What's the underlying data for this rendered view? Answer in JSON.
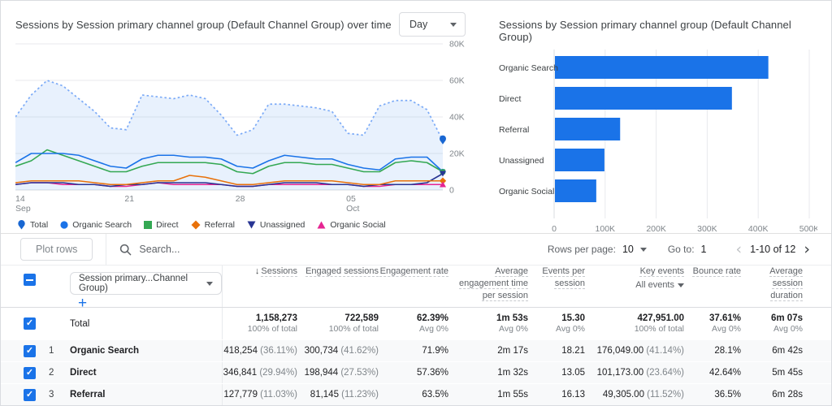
{
  "accent_color": "#1a73e8",
  "line_chart_card": {
    "title": "Sessions by Session primary channel group (Default Channel Group) over time",
    "granularity_value": "Day",
    "legend": [
      {
        "label": "Total",
        "shape": "pin",
        "color": "#1967d2"
      },
      {
        "label": "Organic Search",
        "shape": "circle",
        "color": "#1a73e8"
      },
      {
        "label": "Direct",
        "shape": "square",
        "color": "#34a853"
      },
      {
        "label": "Referral",
        "shape": "diamond",
        "color": "#e8710a"
      },
      {
        "label": "Unassigned",
        "shape": "triangle-down",
        "color": "#283593"
      },
      {
        "label": "Organic Social",
        "shape": "triangle-up",
        "color": "#e52592"
      }
    ]
  },
  "bar_chart_card": {
    "title": "Sessions by Session primary channel group (Default Channel Group)"
  },
  "chart_data": [
    {
      "type": "line",
      "title": "Sessions by Session primary channel group (Default Channel Group) over time",
      "unit": "sessions (thousands)",
      "y_axis": {
        "ticks": [
          "0",
          "20K",
          "40K",
          "60K",
          "80K"
        ],
        "max_k": 80,
        "position": "right"
      },
      "x_axis": {
        "points": 28,
        "tick_labels": [
          {
            "pos": 0,
            "line1": "14",
            "line2": "Sep"
          },
          {
            "pos": 7,
            "line1": "21",
            "line2": ""
          },
          {
            "pos": 14,
            "line1": "28",
            "line2": ""
          },
          {
            "pos": 21,
            "line1": "05",
            "line2": "Oct"
          }
        ]
      },
      "series": [
        {
          "name": "Total",
          "style": "dotted-area",
          "color": "#7baaf7",
          "fill": "rgba(26,115,232,0.10)",
          "marker": "pin",
          "marker_color": "#1967d2",
          "values_k": [
            40,
            52,
            60,
            57,
            50,
            43,
            34,
            33,
            52,
            51,
            50,
            52,
            50,
            41,
            30,
            33,
            47,
            47,
            46,
            45,
            43,
            31,
            30,
            46,
            49,
            49,
            44,
            27
          ]
        },
        {
          "name": "Organic Search",
          "style": "solid",
          "color": "#1a73e8",
          "marker": "circle",
          "marker_color": "#1a73e8",
          "values_k": [
            15,
            20,
            20,
            20,
            19,
            16,
            13,
            12,
            17,
            19,
            19,
            18,
            18,
            17,
            13,
            12,
            16,
            19,
            18,
            17,
            17,
            14,
            12,
            11,
            17,
            18,
            18,
            10
          ]
        },
        {
          "name": "Direct",
          "style": "solid",
          "color": "#34a853",
          "marker": "square",
          "marker_color": "#34a853",
          "values_k": [
            13,
            16,
            22,
            19,
            16,
            13,
            10,
            10,
            13,
            15,
            15,
            15,
            15,
            14,
            10,
            9,
            13,
            15,
            15,
            14,
            14,
            12,
            10,
            10,
            15,
            16,
            15,
            10
          ]
        },
        {
          "name": "Referral",
          "style": "solid",
          "color": "#e8710a",
          "marker": "diamond",
          "marker_color": "#e8710a",
          "values_k": [
            4,
            5,
            5,
            5,
            5,
            4,
            3,
            3,
            4,
            5,
            5,
            8,
            7,
            5,
            3,
            3,
            4,
            5,
            5,
            5,
            5,
            4,
            3,
            3,
            5,
            5,
            5,
            5
          ]
        },
        {
          "name": "Unassigned",
          "style": "solid",
          "color": "#283593",
          "marker": "triangle-down",
          "marker_color": "#283593",
          "values_k": [
            3,
            4,
            4,
            4,
            3,
            3,
            2,
            3,
            3,
            4,
            4,
            4,
            4,
            3,
            2,
            2,
            3,
            4,
            4,
            4,
            3,
            3,
            2,
            3,
            3,
            3,
            4,
            9
          ]
        },
        {
          "name": "Organic Social",
          "style": "solid",
          "color": "#e52592",
          "marker": "triangle-up",
          "marker_color": "#e52592",
          "values_k": [
            3,
            4,
            4,
            3,
            3,
            3,
            2,
            2,
            3,
            4,
            3,
            3,
            3,
            3,
            2,
            2,
            3,
            3,
            3,
            3,
            3,
            3,
            2,
            2,
            3,
            3,
            3,
            3
          ]
        }
      ]
    },
    {
      "type": "bar",
      "orientation": "horizontal",
      "title": "Sessions by Session primary channel group (Default Channel Group)",
      "categories": [
        "Organic Search",
        "Direct",
        "Referral",
        "Unassigned",
        "Organic Social"
      ],
      "values": [
        418254,
        346841,
        127779,
        97000,
        81000
      ],
      "xlim": [
        0,
        500000
      ],
      "x_ticks": [
        "0",
        "100K",
        "200K",
        "300K",
        "400K",
        "500K"
      ],
      "bar_color": "#1a73e8",
      "grid": true
    }
  ],
  "table": {
    "controls": {
      "plot_rows": "Plot rows",
      "search_placeholder": "Search...",
      "rows_per_page_label": "Rows per page:",
      "rows_per_page_value": "10",
      "goto_label": "Go to:",
      "goto_value": "1",
      "range": "1-10 of 12",
      "prev_icon": "‹",
      "next_icon": "›"
    },
    "dimension_dropdown": "Session primary...Channel Group)",
    "add_button": "+",
    "sort_arrow": "↓",
    "columns": [
      {
        "label": "Sessions",
        "sorted": true
      },
      {
        "label": "Engaged sessions"
      },
      {
        "label": "Engagement rate"
      },
      {
        "label": "Average engagement time per session"
      },
      {
        "label": "Events per session"
      },
      {
        "label": "Key events",
        "sub": "All events"
      },
      {
        "label": "Bounce rate"
      },
      {
        "label": "Average session duration"
      }
    ],
    "total_row": {
      "label": "Total",
      "metrics": [
        [
          "1,158,273",
          "100% of total"
        ],
        [
          "722,589",
          "100% of total"
        ],
        [
          "62.39%",
          "Avg 0%"
        ],
        [
          "1m 53s",
          "Avg 0%"
        ],
        [
          "15.30",
          "Avg 0%"
        ],
        [
          "427,951.00",
          "100% of total"
        ],
        [
          "37.61%",
          "Avg 0%"
        ],
        [
          "6m 07s",
          "Avg 0%"
        ]
      ]
    },
    "rows": [
      {
        "index": "1",
        "channel": "Organic Search",
        "metrics": [
          [
            "418,254",
            " (36.11%)"
          ],
          [
            "300,734",
            " (41.62%)"
          ],
          [
            "71.9%",
            ""
          ],
          [
            "2m 17s",
            ""
          ],
          [
            "18.21",
            ""
          ],
          [
            "176,049.00",
            " (41.14%)"
          ],
          [
            "28.1%",
            ""
          ],
          [
            "6m 42s",
            ""
          ]
        ]
      },
      {
        "index": "2",
        "channel": "Direct",
        "metrics": [
          [
            "346,841",
            " (29.94%)"
          ],
          [
            "198,944",
            " (27.53%)"
          ],
          [
            "57.36%",
            ""
          ],
          [
            "1m 32s",
            ""
          ],
          [
            "13.05",
            ""
          ],
          [
            "101,173.00",
            " (23.64%)"
          ],
          [
            "42.64%",
            ""
          ],
          [
            "5m 45s",
            ""
          ]
        ]
      },
      {
        "index": "3",
        "channel": "Referral",
        "metrics": [
          [
            "127,779",
            " (11.03%)"
          ],
          [
            "81,145",
            " (11.23%)"
          ],
          [
            "63.5%",
            ""
          ],
          [
            "1m 55s",
            ""
          ],
          [
            "16.13",
            ""
          ],
          [
            "49,305.00",
            " (11.52%)"
          ],
          [
            "36.5%",
            ""
          ],
          [
            "6m 28s",
            ""
          ]
        ]
      }
    ]
  }
}
